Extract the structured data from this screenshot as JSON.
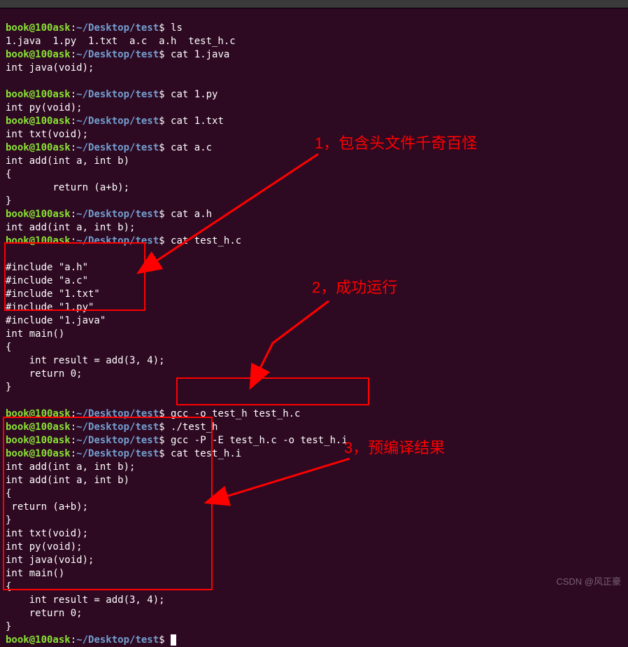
{
  "prompt": {
    "user": "book@100ask",
    "host_sep": ":",
    "path": "~/Desktop/test",
    "symbol": "$"
  },
  "lines": {
    "ls_cmd": "ls",
    "ls_out": "1.java  1.py  1.txt  a.c  a.h  test_h.c",
    "cat_java_cmd": "cat 1.java",
    "cat_java_out": "int java(void);",
    "cat_py_cmd": "cat 1.py",
    "cat_py_out": "int py(void);",
    "cat_txt_cmd": "cat 1.txt",
    "cat_txt_out": "int txt(void);",
    "cat_ac_cmd": "cat a.c",
    "cat_ac_out1": "int add(int a, int b)",
    "cat_ac_out2": "{",
    "cat_ac_out3": "        return (a+b);",
    "cat_ac_out4": "}",
    "cat_ah_cmd": "cat a.h",
    "cat_ah_out": "int add(int a, int b);",
    "cat_test_cmd": "cat test_h.c",
    "inc1": "#include \"a.h\"",
    "inc2": "#include \"a.c\"",
    "inc3": "#include \"1.txt\"",
    "inc4": "#include \"1.py\"",
    "inc5": "#include \"1.java\"",
    "main1": "int main()",
    "main2": "{",
    "main3": "    int result = add(3, 4);",
    "main4": "    return 0;",
    "main5": "}",
    "gcc_cmd": "gcc -o test_h test_h.c",
    "run_cmd": "./test_h",
    "gcc_e_cmd": "gcc -P -E test_h.c -o test_h.i",
    "cat_i_cmd": "cat test_h.i",
    "pre1": "int add(int a, int b);",
    "pre2": "int add(int a, int b)",
    "pre3": "{",
    "pre4": " return (a+b);",
    "pre5": "}",
    "pre6": "int txt(void);",
    "pre7": "int py(void);",
    "pre8": "int java(void);",
    "pre9": "int main()",
    "pre10": "{",
    "pre11": "    int result = add(3, 4);",
    "pre12": "    return 0;",
    "pre13": "}"
  },
  "annotations": {
    "a1": "1，包含头文件千奇百怪",
    "a2": "2，成功运行",
    "a3": "3，预编译结果"
  },
  "watermark": "CSDN @风正豪"
}
